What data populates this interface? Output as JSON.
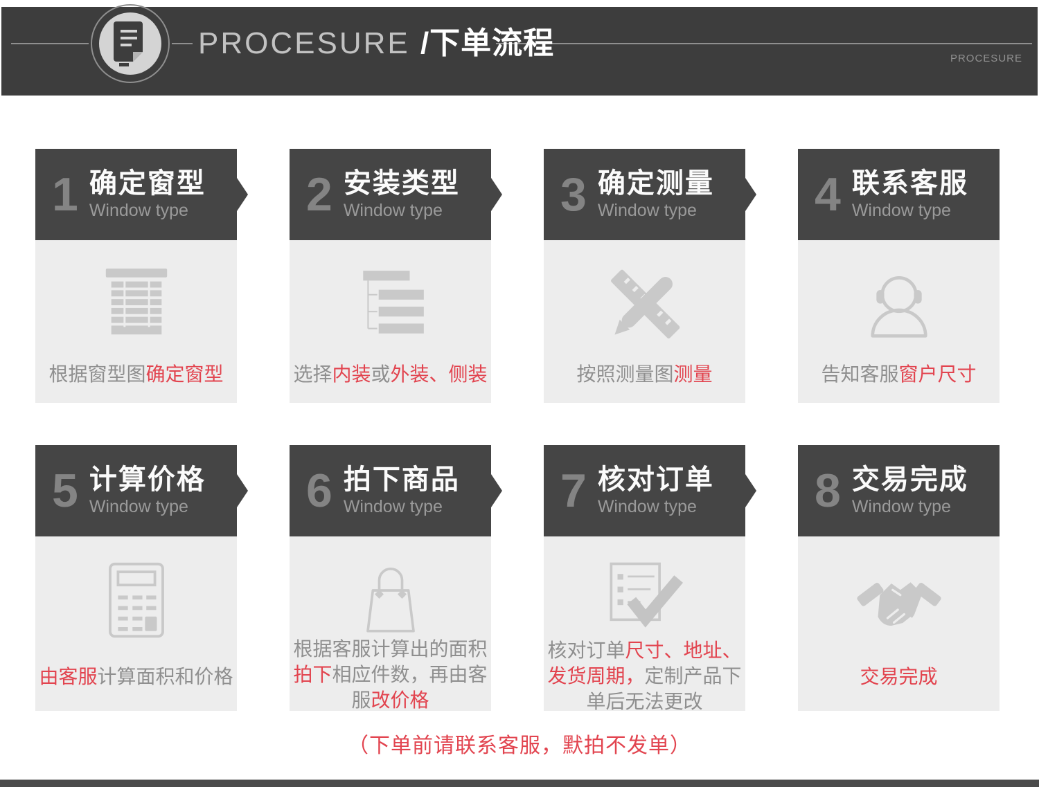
{
  "banner": {
    "title_en": "PROCESURE ",
    "title_zh": "/下单流程",
    "corner_label": "PROCESURE",
    "icon": "document-icon"
  },
  "steps": [
    {
      "number": "1",
      "title": "确定窗型",
      "subtitle": "Window type",
      "icon": "blinds-icon",
      "has_arrow": true,
      "desc": [
        {
          "text": "根据窗型图",
          "color": "gray"
        },
        {
          "text": "确定窗型",
          "color": "red"
        }
      ]
    },
    {
      "number": "2",
      "title": "安装类型",
      "subtitle": "Window type",
      "icon": "install-type-icon",
      "has_arrow": true,
      "desc": [
        {
          "text": "选择",
          "color": "gray"
        },
        {
          "text": "内装",
          "color": "red"
        },
        {
          "text": "或",
          "color": "gray"
        },
        {
          "text": "外装、侧装",
          "color": "red"
        }
      ]
    },
    {
      "number": "3",
      "title": "确定测量",
      "subtitle": "Window type",
      "icon": "measure-icon",
      "has_arrow": true,
      "desc": [
        {
          "text": "按照测量图",
          "color": "gray"
        },
        {
          "text": "测量",
          "color": "red"
        }
      ]
    },
    {
      "number": "4",
      "title": "联系客服",
      "subtitle": "Window type",
      "icon": "customer-service-icon",
      "has_arrow": false,
      "desc": [
        {
          "text": "告知客服",
          "color": "gray"
        },
        {
          "text": "窗户尺寸",
          "color": "red"
        }
      ]
    },
    {
      "number": "5",
      "title": "计算价格",
      "subtitle": "Window type",
      "icon": "calculator-icon",
      "has_arrow": true,
      "desc": [
        {
          "text": "由客服",
          "color": "red"
        },
        {
          "text": "计算面积和价格",
          "color": "gray"
        }
      ]
    },
    {
      "number": "6",
      "title": "拍下商品",
      "subtitle": "Window type",
      "icon": "shopping-bag-icon",
      "has_arrow": true,
      "desc": [
        {
          "text": "根据客服计算出的面积",
          "color": "gray"
        },
        {
          "text": "拍下",
          "color": "red"
        },
        {
          "text": "相应件数，再由客服",
          "color": "gray"
        },
        {
          "text": "改价格",
          "color": "red"
        }
      ]
    },
    {
      "number": "7",
      "title": "核对订单",
      "subtitle": "Window type",
      "icon": "order-check-icon",
      "has_arrow": true,
      "desc": [
        {
          "text": "核对订单",
          "color": "gray"
        },
        {
          "text": "尺寸、地址、发货周期，",
          "color": "red"
        },
        {
          "text": "定制产品下单后无法更改",
          "color": "gray"
        }
      ]
    },
    {
      "number": "8",
      "title": "交易完成",
      "subtitle": "Window type",
      "icon": "handshake-icon",
      "has_arrow": false,
      "desc": [
        {
          "text": "交易完成",
          "color": "red"
        }
      ]
    }
  ],
  "footer": {
    "note": "（下单前请联系客服，默拍不发单）"
  },
  "colors": {
    "banner_bg": "#3d3d3d",
    "card_header_bg": "#454545",
    "card_body_bg": "#ededed",
    "accent_red": "#e2444f",
    "icon_gray": "#c9c9c9",
    "text_gray": "#8f8f8f",
    "bottom_bar": "#4b4b4b"
  }
}
